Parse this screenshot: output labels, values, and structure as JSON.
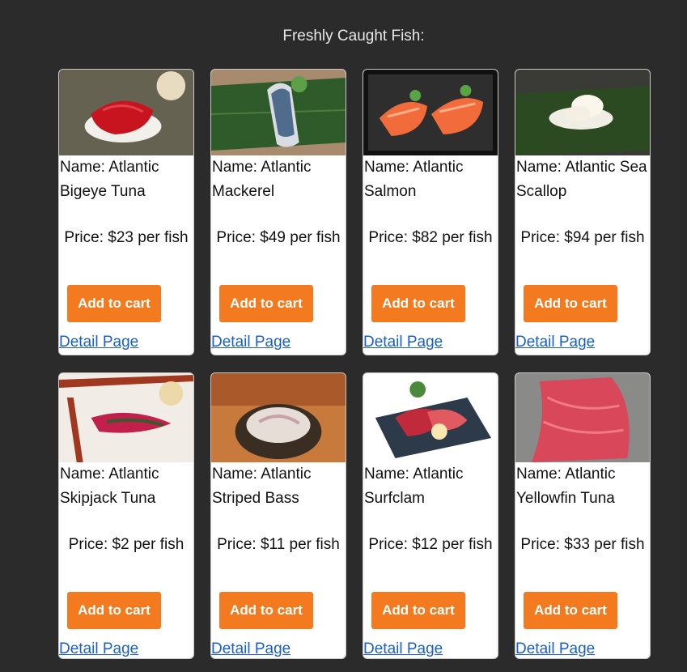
{
  "header": {
    "title": "Freshly Caught Fish:"
  },
  "products": [
    {
      "name": "Name: Atlantic Bigeye Tuna",
      "price": "Price: $23 per fish",
      "add_label": "Add to cart",
      "detail_label": "Detail Page",
      "image": "bigeye-tuna-nigiri-image"
    },
    {
      "name": "Name: Atlantic Mackerel",
      "price": "Price: $49 per fish",
      "add_label": "Add to cart",
      "detail_label": "Detail Page",
      "image": "mackerel-nigiri-image"
    },
    {
      "name": "Name: Atlantic Salmon",
      "price": "Price: $82 per fish",
      "add_label": "Add to cart",
      "detail_label": "Detail Page",
      "image": "salmon-nigiri-image"
    },
    {
      "name": "Name: Atlantic Sea Scallop",
      "price": "Price: $94 per fish",
      "add_label": "Add to cart",
      "detail_label": "Detail Page",
      "image": "scallop-nigiri-image"
    },
    {
      "name": "Name: Atlantic Skipjack Tuna",
      "price": "Price: $2 per fish",
      "add_label": "Add to cart",
      "detail_label": "Detail Page",
      "image": "skipjack-tuna-nigiri-image"
    },
    {
      "name": "Name: Atlantic Striped Bass",
      "price": "Price: $11 per fish",
      "add_label": "Add to cart",
      "detail_label": "Detail Page",
      "image": "striped-bass-sashimi-image"
    },
    {
      "name": "Name: Atlantic Surfclam",
      "price": "Price: $12 per fish",
      "add_label": "Add to cart",
      "detail_label": "Detail Page",
      "image": "surfclam-sashimi-image"
    },
    {
      "name": "Name: Atlantic Yellowfin Tuna",
      "price": "Price: $33 per fish",
      "add_label": "Add to cart",
      "detail_label": "Detail Page",
      "image": "yellowfin-tuna-image"
    }
  ],
  "colors": {
    "button": "#f47a1f",
    "link": "#1a5fc9",
    "background": "#2b2b2b"
  }
}
